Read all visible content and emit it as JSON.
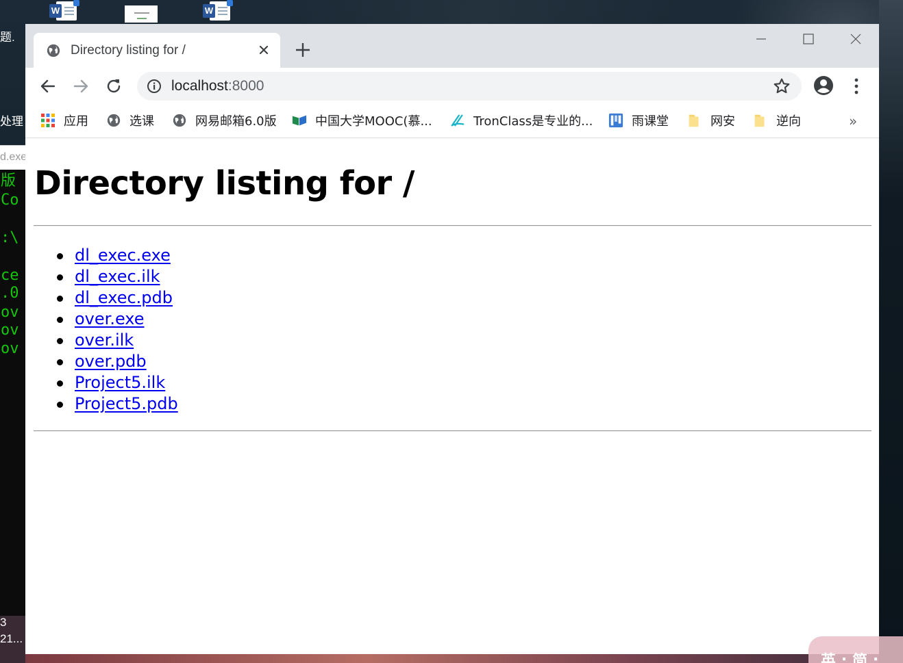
{
  "tab": {
    "title": "Directory listing for /"
  },
  "omnibox": {
    "host": "localhost",
    "port": ":8000"
  },
  "bookmarks": [
    {
      "label": "应用",
      "icon": "apps-grid-icon"
    },
    {
      "label": "选课",
      "icon": "globe-icon"
    },
    {
      "label": "网易邮箱6.0版",
      "icon": "globe-icon"
    },
    {
      "label": "中国大学MOOC(慕...",
      "icon": "mooc-icon"
    },
    {
      "label": "TronClass是专业的...",
      "icon": "tronclass-icon"
    },
    {
      "label": "雨课堂",
      "icon": "rainclass-icon"
    },
    {
      "label": "网安",
      "icon": "folder-icon"
    },
    {
      "label": "逆向",
      "icon": "folder-icon"
    }
  ],
  "bookmarks_more": "»",
  "page": {
    "heading": "Directory listing for /",
    "files": [
      "dl_exec.exe",
      "dl_exec.ilk",
      "dl_exec.pdb",
      "over.exe",
      "over.ilk",
      "over.pdb",
      "Project5.ilk",
      "Project5.pdb"
    ]
  },
  "desktop": {
    "left_texts": [
      "题.",
      "处理",
      "d.exe",
      "版",
      "Co",
      ":\\",
      "ce",
      ".0",
      "ov",
      "ov",
      "ov",
      "3",
      "21..."
    ],
    "ime_text": "英 ; 简 ;"
  },
  "colors": {
    "link": "#0000ee",
    "tabstrip": "#dee1e6",
    "console_green": "#16c60c"
  }
}
